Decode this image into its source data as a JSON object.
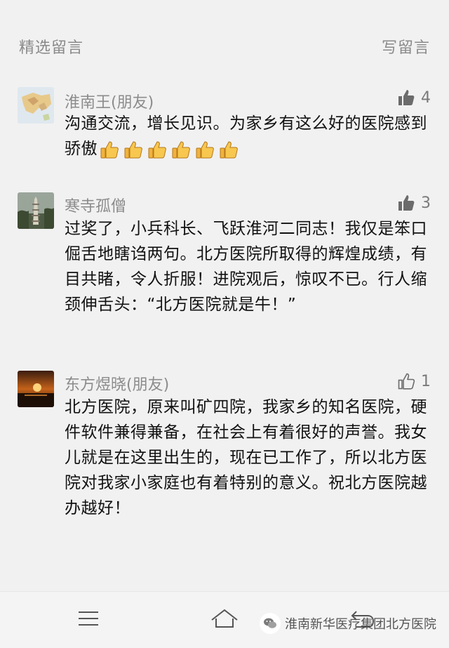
{
  "header": {
    "title": "精选留言",
    "write_label": "写留言"
  },
  "comments": [
    {
      "name": "淮南王(朋友)",
      "likes": "4",
      "liked": true,
      "text": "沟通交流，增长见识。为家乡有这么好的医院感到骄傲",
      "emoji_count": 6
    },
    {
      "name": "寒寺孤僧",
      "likes": "3",
      "liked": true,
      "text": "过奖了，小兵科长、飞跃淮河二同志！我仅是笨口倔舌地瞎诌两句。北方医院所取得的辉煌成绩，有目共睹，令人折服！进院观后，惊叹不已。行人缩颈伸舌头：“北方医院就是牛！”"
    },
    {
      "name": "东方煜晓(朋友)",
      "likes": "1",
      "liked": false,
      "text": "北方医院，原来叫矿四院，我家乡的知名医院，硬件软件兼得兼备，在社会上有着很好的声誉。我女儿就是在这里出生的，现在已工作了，所以北方医院对我家小家庭也有着特别的意义。祝北方医院越办越好！"
    }
  ],
  "watermark": {
    "text": "淮南新华医疗集团北方医院"
  },
  "icons": {
    "like_filled": "thumbs-up-filled-icon",
    "like_outline": "thumbs-up-outline-icon",
    "menu": "menu-icon",
    "home": "home-icon",
    "back": "back-icon"
  }
}
